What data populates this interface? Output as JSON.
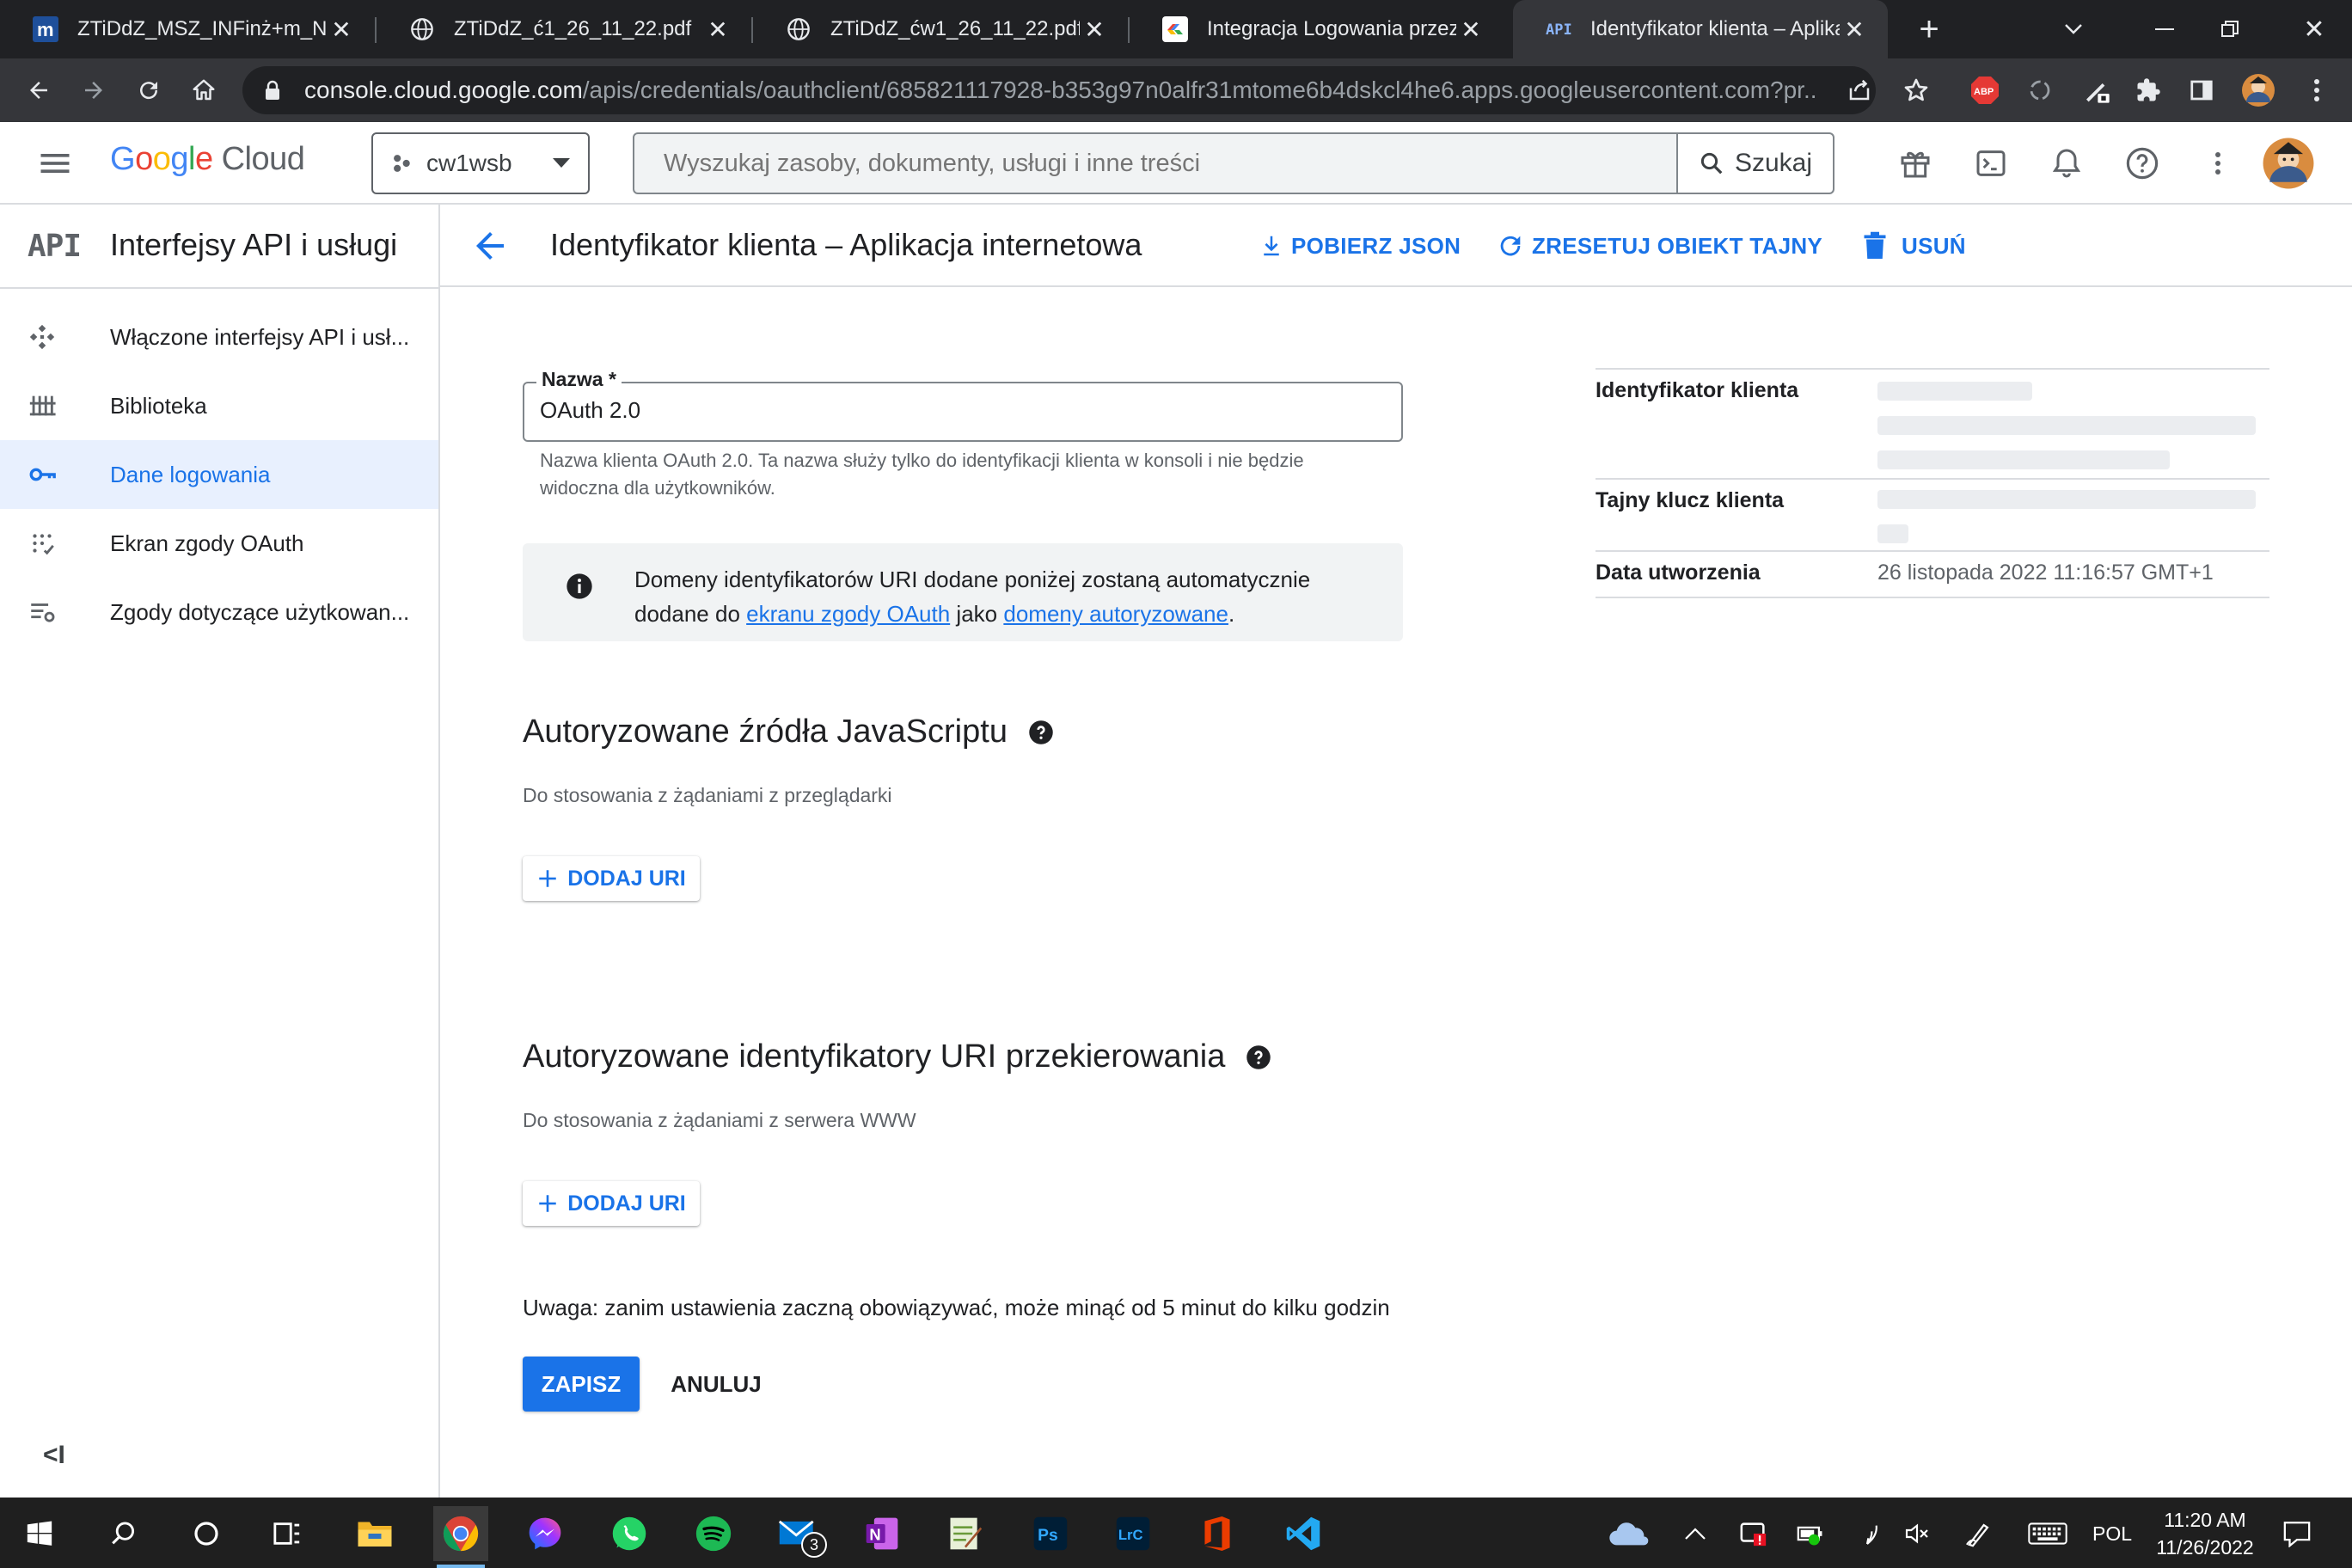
{
  "browser": {
    "tabs": [
      {
        "title": "ZTiDdZ_MSZ_INFinż+m_NW_",
        "icon": "moodle-icon"
      },
      {
        "title": "ZTiDdZ_ć1_26_11_22.pdf",
        "icon": "globe-icon"
      },
      {
        "title": "ZTiDdZ_ćw1_26_11_22.pdf",
        "icon": "globe-icon"
      },
      {
        "title": "Integracja Logowania przez G",
        "icon": "google-cloud-icon"
      },
      {
        "title": "Identyfikator klienta – Aplikac",
        "icon": "api-icon"
      }
    ],
    "url_host": "console.cloud.google.com",
    "url_path": "/apis/credentials/oauthclient/685821117928-b353g97n0alfr31mtome6b4dskcl4he6.apps.googleusercontent.com?pr..."
  },
  "header": {
    "logo_google": [
      "G",
      "o",
      "o",
      "g",
      "l",
      "e"
    ],
    "logo_cloud": "Cloud",
    "project": "cw1wsb",
    "search_placeholder": "Wyszukaj zasoby, dokumenty, usługi i inne treści",
    "search_button": "Szukaj"
  },
  "sidebar": {
    "badge": "API",
    "title": "Interfejsy API i usługi",
    "items": [
      {
        "label": "Włączone interfejsy API i usł...",
        "icon": "api-diamond-icon",
        "selected": false
      },
      {
        "label": "Biblioteka",
        "icon": "library-icon",
        "selected": false
      },
      {
        "label": "Dane logowania",
        "icon": "key-icon",
        "selected": true
      },
      {
        "label": "Ekran zgody OAuth",
        "icon": "consent-grid-icon",
        "selected": false
      },
      {
        "label": "Zgody dotyczące użytkowan...",
        "icon": "settings-list-icon",
        "selected": false
      }
    ],
    "collapse": "<I"
  },
  "page": {
    "title": "Identyfikator klienta – Aplikacja internetowa",
    "actions": {
      "download": "POBIERZ JSON",
      "reset": "ZRESETUJ OBIEKT TAJNY",
      "delete": "USUŃ"
    }
  },
  "form": {
    "name_label": "Nazwa *",
    "name_value": "OAuth 2.0",
    "name_hint": "Nazwa klienta OAuth 2.0. Ta nazwa służy tylko do identyfikacji klienta w konsoli i nie będzie widoczna dla użytkowników.",
    "info_part1": "Domeny identyfikatorów URI dodane poniżej zostaną automatycznie dodane do",
    "info_link1": "ekranu zgody OAuth",
    "info_mid": "jako",
    "info_link2": "domeny autoryzowane",
    "info_end": ".",
    "js_title": "Autoryzowane źródła JavaScriptu",
    "js_sub": "Do stosowania z żądaniami z przeglądarki",
    "add_uri": "DODAJ URI",
    "redirect_title": "Autoryzowane identyfikatory URI przekierowania",
    "redirect_sub": "Do stosowania z żądaniami z serwera WWW",
    "warning": "Uwaga: zanim ustawienia zaczną obowiązywać, może minąć od 5 minut do kilku godzin",
    "save": "ZAPISZ",
    "cancel": "ANULUJ"
  },
  "details": {
    "client_id_label": "Identyfikator klienta",
    "client_secret_label": "Tajny klucz klienta",
    "created_label": "Data utworzenia",
    "created_value": "26 listopada 2022 11:16:57 GMT+1"
  },
  "taskbar": {
    "mail_badge": "3",
    "language": "POL",
    "time": "11:20 AM",
    "date": "11/26/2022"
  },
  "colors": {
    "accent": "#1a73e8",
    "selected_bg": "#e8f0fe",
    "chrome_dark": "#202124"
  }
}
